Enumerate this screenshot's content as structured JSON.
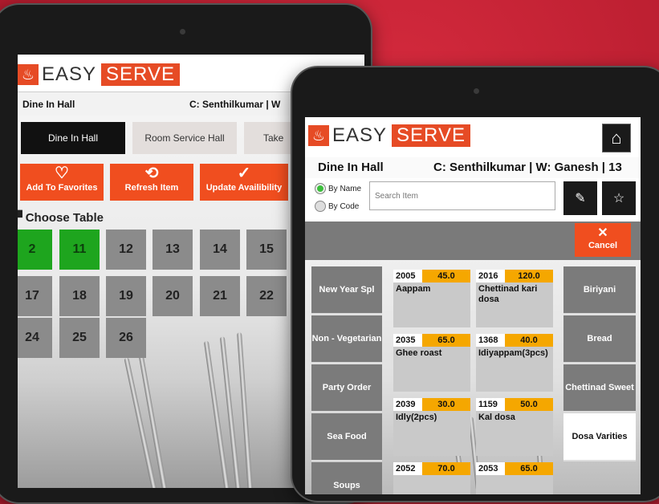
{
  "brand": {
    "easy": "EASY",
    "serve": "SERVE"
  },
  "left": {
    "hall": "Dine In Hall",
    "captain": "C: Senthilkumar  |  W",
    "halls": [
      "Dine In Hall",
      "Room Service Hall",
      "Take"
    ],
    "actions": [
      "Add To Favorites",
      "Refresh Item",
      "Update Availibility"
    ],
    "choose_table": "Choose Table",
    "tables": [
      "2",
      "11",
      "12",
      "13",
      "14",
      "15",
      "17",
      "18",
      "19",
      "20",
      "21",
      "22",
      "24",
      "25",
      "26"
    ]
  },
  "right": {
    "hall": "Dine In Hall",
    "captain": "C: Senthilkumar | W: Ganesh | 13",
    "by_name": "By Name",
    "by_code": "By Code",
    "search_placeholder": "Search Item",
    "cancel": "Cancel",
    "categories": [
      "New Year Spl",
      "Non - Vegetarian",
      "Party Order",
      "Sea Food",
      "Soups"
    ],
    "right_categories": [
      "Biriyani",
      "Bread",
      "Chettinad Sweet",
      "Dosa Varities"
    ],
    "items": [
      {
        "code": "2005",
        "price": "45.0",
        "name": "Aappam"
      },
      {
        "code": "2016",
        "price": "120.0",
        "name": "Chettinad kari dosa"
      },
      {
        "code": "2035",
        "price": "65.0",
        "name": "Ghee roast"
      },
      {
        "code": "1368",
        "price": "40.0",
        "name": "Idiyappam(3pcs)"
      },
      {
        "code": "2039",
        "price": "30.0",
        "name": "Idly(2pcs)"
      },
      {
        "code": "1159",
        "price": "50.0",
        "name": "Kal dosa"
      },
      {
        "code": "2052",
        "price": "70.0",
        "name": ""
      },
      {
        "code": "2053",
        "price": "65.0",
        "name": ""
      }
    ]
  },
  "colors": {
    "brand_orange": "#f04e1f",
    "available_green": "#1ea51e",
    "price_amber": "#f5a700",
    "background_red": "#b81d2f"
  }
}
